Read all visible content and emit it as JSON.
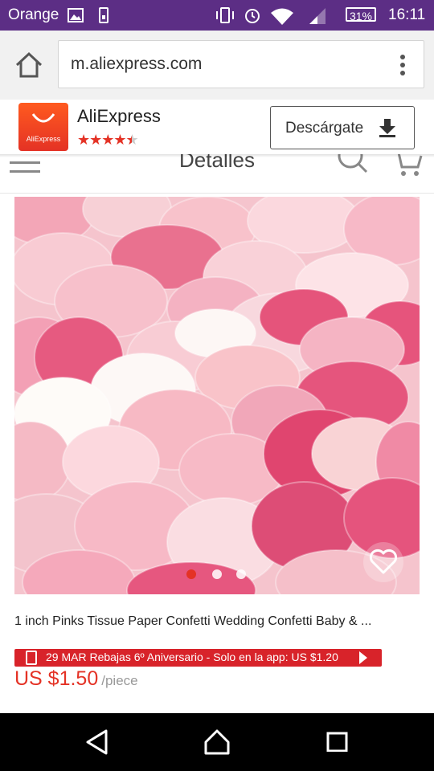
{
  "status_bar": {
    "carrier": "Orange",
    "battery": "31%",
    "time": "16:11"
  },
  "browser": {
    "url": "m.aliexpress.com"
  },
  "app_banner": {
    "name": "AliExpress",
    "logo_text": "AliExpress",
    "rating": 4.5,
    "download_label": "Descárgate"
  },
  "page_header": {
    "title": "Detalles"
  },
  "product": {
    "image_slides": 3,
    "active_slide": 1,
    "title": "1 inch Pinks Tissue Paper Confetti Wedding Confetti Baby & ...",
    "promo_text": "29 MAR Rebajas 6º Aniversario - Solo en la app: US $1.20",
    "price": "US $1.50",
    "price_unit": "/piece"
  },
  "colors": {
    "status_bar": "#5c2e85",
    "accent_red": "#e43225",
    "promo_red": "#d8232a"
  },
  "icons": [
    "image-icon",
    "sim-icon",
    "vibrate-icon",
    "alarm-icon",
    "wifi-icon",
    "signal-icon",
    "home-icon",
    "menu-dots-icon",
    "download-icon",
    "hamburger-icon",
    "search-icon",
    "cart-icon",
    "heart-icon",
    "back-nav-icon",
    "home-nav-icon",
    "recents-nav-icon"
  ]
}
